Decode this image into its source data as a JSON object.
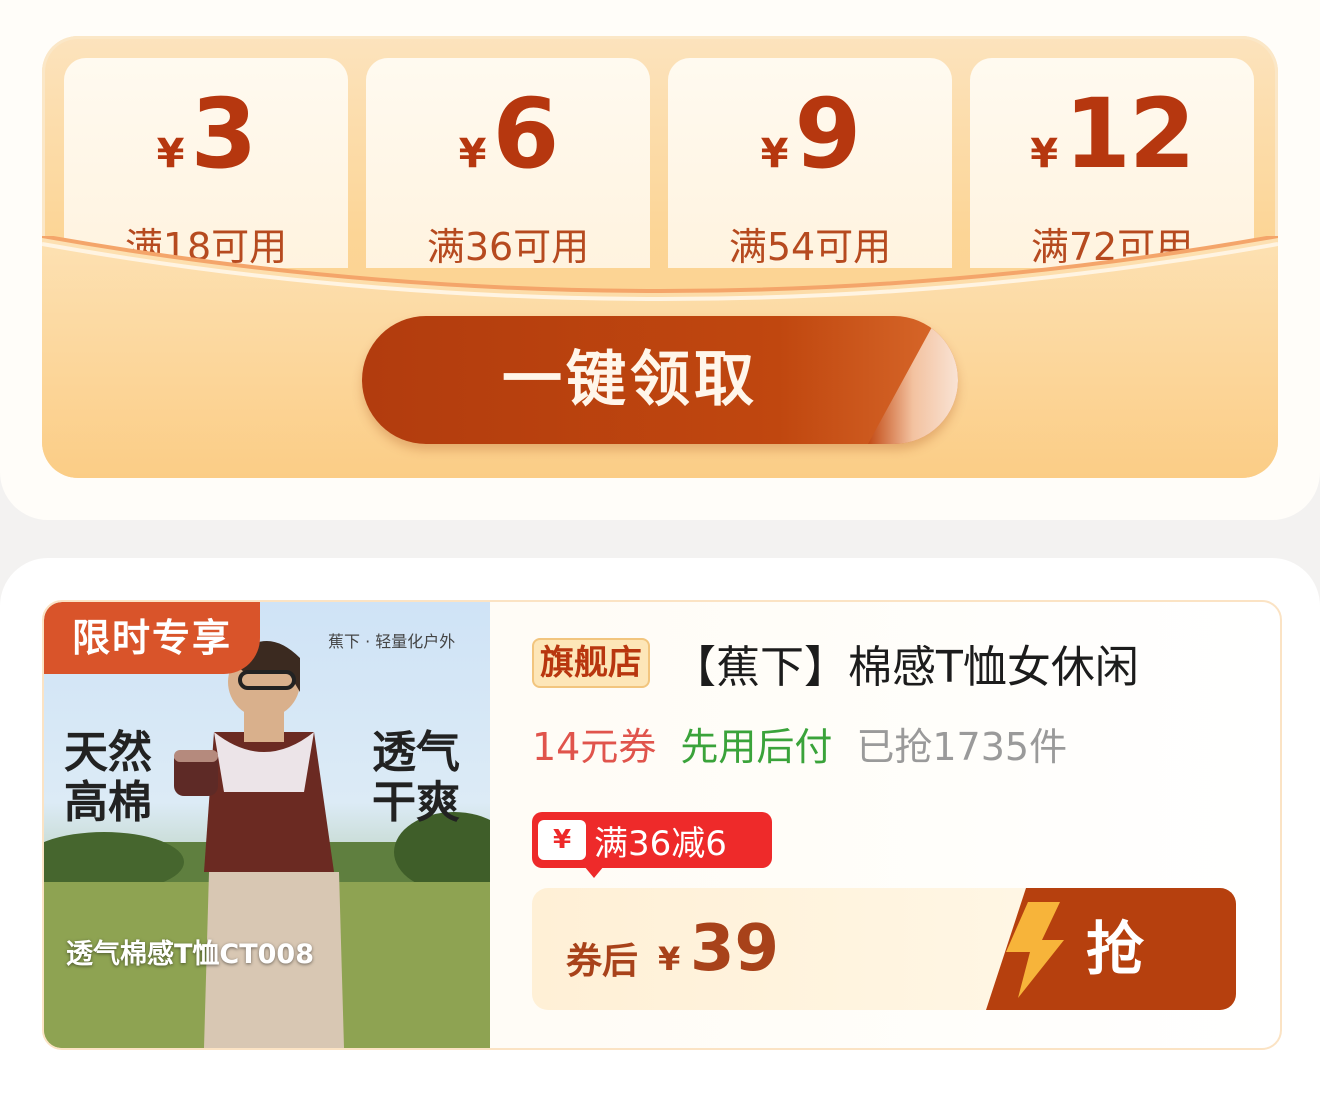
{
  "coupons": [
    {
      "currency": "¥",
      "amount": "3",
      "condition": "满18可用"
    },
    {
      "currency": "¥",
      "amount": "6",
      "condition": "满36可用"
    },
    {
      "currency": "¥",
      "amount": "9",
      "condition": "满54可用"
    },
    {
      "currency": "¥",
      "amount": "12",
      "condition": "满72可用"
    }
  ],
  "claim_button": {
    "label": "一键领取"
  },
  "product": {
    "image": {
      "badge": "限时专享",
      "brand": "蕉下 · 轻量化户外",
      "left_text_1": "天然",
      "left_text_2": "高棉",
      "right_text_1": "透气",
      "right_text_2": "干爽",
      "caption": "透气棉感T恤CT008"
    },
    "store_badge": "旗舰店",
    "title": "【蕉下】棉感T恤女休闲",
    "tags": {
      "coupon": "14元券",
      "pay_later": "先用后付",
      "sold": "已抢1735件"
    },
    "promo": {
      "icon": "¥",
      "text": "满36减6"
    },
    "price": {
      "label": "券后",
      "currency": "¥",
      "value": "39"
    },
    "grab_button": {
      "label": "抢"
    }
  },
  "colors": {
    "accent": "#b6400e",
    "coupon_text": "#b6370f",
    "promo_red": "#ee2a2a",
    "green_tag": "#3aa33a"
  }
}
